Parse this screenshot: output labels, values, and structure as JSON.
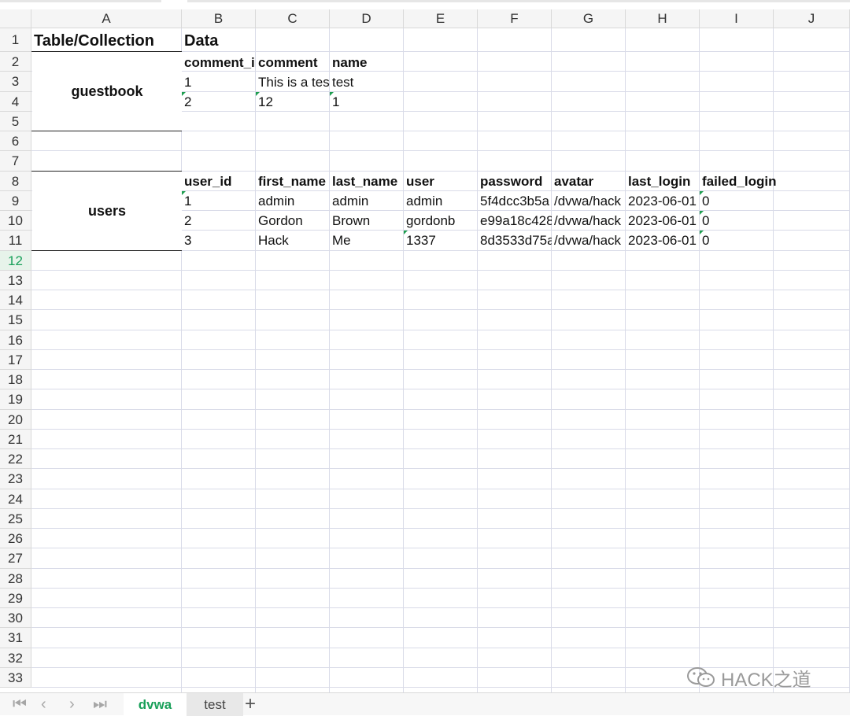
{
  "columns": [
    "A",
    "B",
    "C",
    "D",
    "E",
    "F",
    "G",
    "H",
    "I",
    "J"
  ],
  "rows": [
    "1",
    "2",
    "3",
    "4",
    "5",
    "6",
    "7",
    "8",
    "9",
    "10",
    "11",
    "12",
    "13",
    "14",
    "15",
    "16",
    "17",
    "18",
    "19",
    "20",
    "21",
    "22",
    "23",
    "24",
    "25",
    "26",
    "27",
    "28",
    "29",
    "30",
    "31",
    "32",
    "33"
  ],
  "active_row": "12",
  "cells": {
    "A1": "Table/Collection",
    "B1": "Data",
    "guestbook": "guestbook",
    "users": "users",
    "B2": "comment_i",
    "C2": "comment",
    "D2": "name",
    "B3": "1",
    "C3": "This is a tes",
    "D3": "test",
    "B4": "2",
    "C4": "12",
    "D4": "1",
    "B8": "user_id",
    "C8": "first_name",
    "D8": "last_name",
    "E8": "user",
    "F8": "password",
    "G8": "avatar",
    "H8": "last_login",
    "I8": "failed_login",
    "B9": "1",
    "C9": "admin",
    "D9": "admin",
    "E9": "admin",
    "F9": "5f4dcc3b5a",
    "G9": "/dvwa/hack",
    "H9": "2023-06-01",
    "I9": "0",
    "B10": "2",
    "C10": "Gordon",
    "D10": "Brown",
    "E10": "gordonb",
    "F10": "e99a18c428",
    "G10": "/dvwa/hack",
    "H10": "2023-06-01",
    "I10": "0",
    "B11": "3",
    "C11": "Hack",
    "D11": "Me",
    "E11": "1337",
    "F11": "8d3533d75a",
    "G11": "/dvwa/hack",
    "H11": "2023-06-01",
    "I11": "0"
  },
  "tabs": [
    {
      "label": "dvwa",
      "active": true
    },
    {
      "label": "test",
      "active": false
    }
  ],
  "nav_icons": [
    "first-sheet-icon",
    "prev-sheet-icon",
    "next-sheet-icon",
    "last-sheet-icon"
  ],
  "add_sheet_label": "+",
  "watermark": "HACK之道",
  "colors": {
    "accent": "#1aa05a",
    "grid": "#d9dbe8",
    "header_bg": "#f5f5f5"
  }
}
